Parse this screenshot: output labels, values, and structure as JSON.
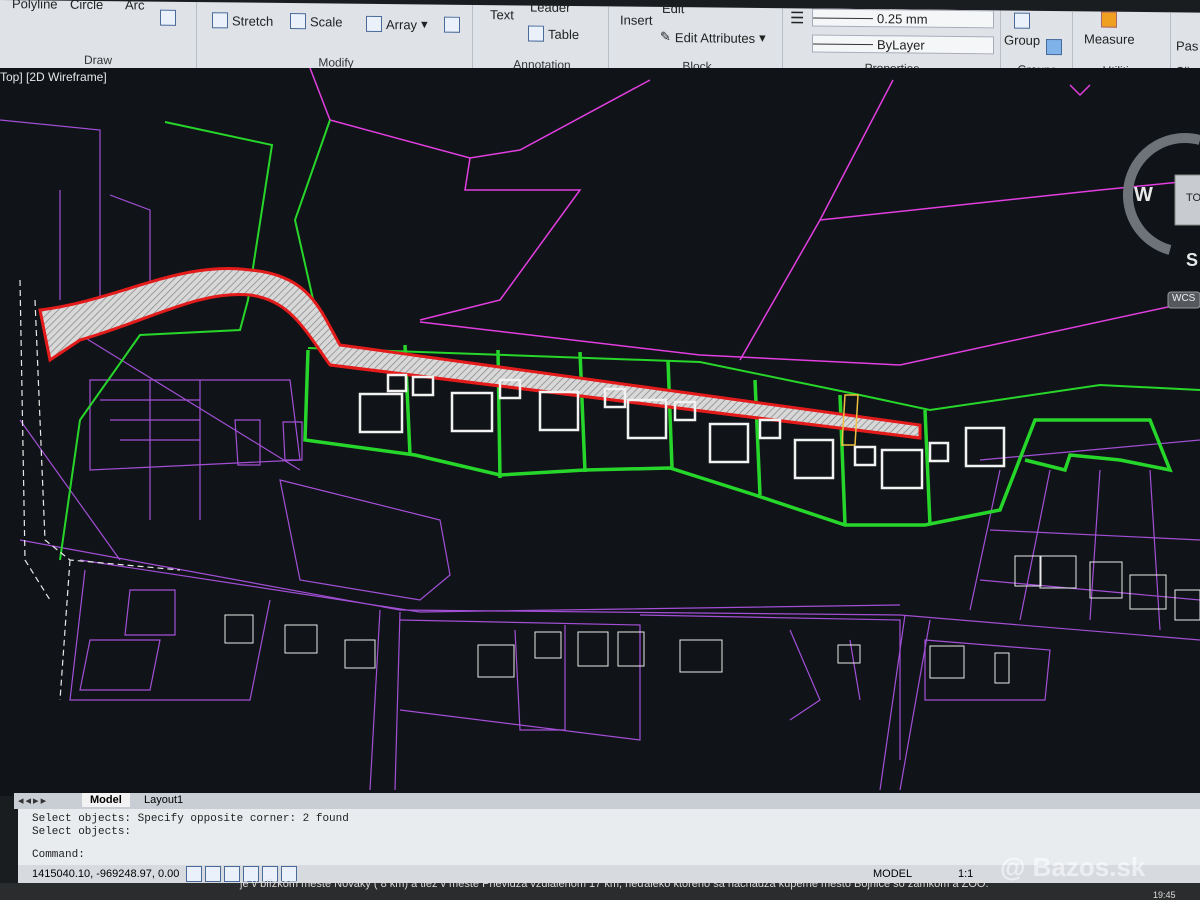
{
  "ribbon": {
    "draw": {
      "polyline": "Polyline",
      "circle": "Circle",
      "arc": "Arc",
      "title": "Draw"
    },
    "modify": {
      "stretch": "Stretch",
      "scale": "Scale",
      "array": "Array",
      "title": "Modify"
    },
    "annotation": {
      "text": "Text",
      "leader": "Leader",
      "table": "Table",
      "title": "Annotation"
    },
    "block": {
      "insert": "Insert",
      "edit": "Edit",
      "edit_attributes": "Edit Attributes",
      "title": "Block"
    },
    "properties": {
      "lineweight": "0.25 mm",
      "linetype": "ByLayer",
      "title": "Properties"
    },
    "groups": {
      "group": "Group",
      "title": "Groups"
    },
    "utilities": {
      "measure": "Measure",
      "title": "Utilities"
    },
    "clipboard": {
      "paste": "Pas",
      "title": "Clip"
    }
  },
  "viewport": {
    "label": "Top] [2D Wireframe]"
  },
  "viewcube": {
    "west": "W",
    "top": "TO",
    "south": "S",
    "wcs": "WCS"
  },
  "tabs": {
    "model": "Model",
    "layout1": "Layout1"
  },
  "command": {
    "line1": "Select objects: Specify opposite corner: 2 found",
    "line2": "Select objects:",
    "prompt": "Command:"
  },
  "status": {
    "coords": "1415040.10, -969248.97, 0.00",
    "model": "MODEL",
    "scale": "1:1"
  },
  "caption": {
    "text": "je v blízkom meste Nováky ( 8 km) a tiež v meste Prievidza vzdialenom 17 km, neďaleko ktorého sa nachádza kúpeľné mesto Bojnice so zámkom a ZOO."
  },
  "watermark": "@ Bazos.sk",
  "clock": "19:45",
  "colors": {
    "parcel": "#b04be0",
    "plot": "#27d62a",
    "road": "#e31b1b",
    "building": "#f2f2f2",
    "magenta": "#e23ee0"
  }
}
